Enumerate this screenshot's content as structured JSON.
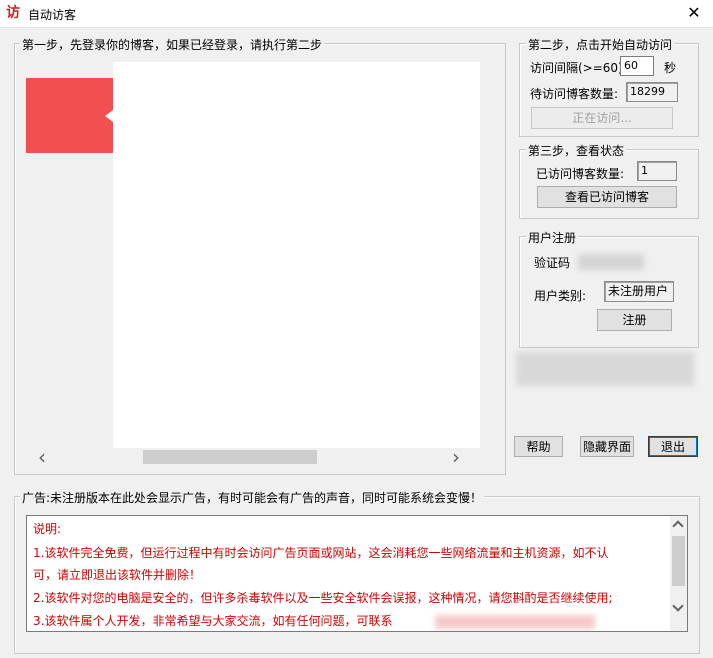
{
  "window": {
    "title": "自动访客",
    "icon_text": "访",
    "close_label": "✕"
  },
  "step1": {
    "legend": "第一步，先登录你的博客，如果已经登录，请执行第二步"
  },
  "browser": {
    "scroll_left": "‹",
    "scroll_right": "›",
    "flag_color": "#f25050"
  },
  "step2": {
    "legend": "第二步，点击开始自动访问",
    "interval_label": "访问间隔(>=60)",
    "interval_value": "60",
    "interval_unit": "秒",
    "pending_label": "待访问博客数量:",
    "pending_value": "18299",
    "visiting_button": "正在访问..."
  },
  "step3": {
    "legend": "第三步，查看状态",
    "visited_label": "已访问博客数量:",
    "visited_value": "1",
    "view_button": "查看已访问博客"
  },
  "register": {
    "legend": "用户注册",
    "code_label": "验证码",
    "type_label": "用户类别:",
    "type_value": "未注册用户",
    "register_button": "注册"
  },
  "actions": {
    "help": "帮助",
    "hide": "隐藏界面",
    "exit": "退出"
  },
  "ad": {
    "legend": "广告:未注册版本在此处会显示广告，有时可能会有广告的声音，同时可能系统会变慢！",
    "lines": [
      "说明:",
      "1.该软件完全免费，但运行过程中有时会访问广告页面或网站，这会消耗您一些网络流量和主机资源，如不认",
      "可，请立即退出该软件并删除！",
      "2.该软件对您的电脑是安全的，但许多杀毒软件以及一些安全软件会误报，这种情况，请您斟酌是否继续使用;",
      "3.该软件属个人开发，非常希望与大家交流，如有任何问题，可联系"
    ]
  }
}
